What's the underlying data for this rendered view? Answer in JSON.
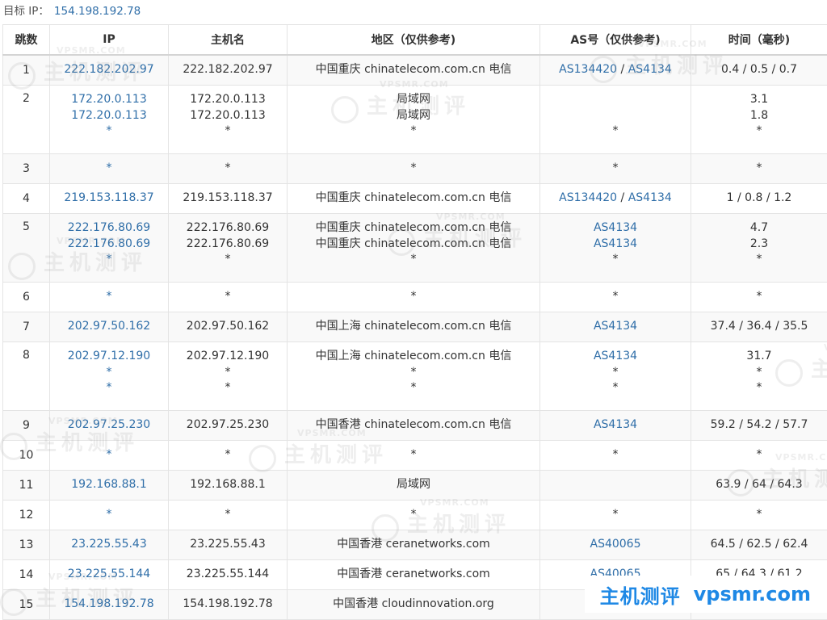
{
  "target": {
    "label": "目标 IP：",
    "ip": "154.198.192.78"
  },
  "headers": [
    "跳数",
    "IP",
    "主机名",
    "地区（仅供参考)",
    "AS号（仅供参考)",
    "时间（毫秒)"
  ],
  "hops": [
    {
      "hop": "1",
      "ip": [
        "222.182.202.97"
      ],
      "host": [
        "222.182.202.97"
      ],
      "region": [
        "中国重庆 chinatelecom.com.cn 电信"
      ],
      "as": [
        [
          "AS134420",
          "AS4134"
        ]
      ],
      "time": [
        "0.4 / 0.5 / 0.7"
      ]
    },
    {
      "hop": "2",
      "ip": [
        "172.20.0.113",
        "172.20.0.113",
        "*"
      ],
      "host": [
        "172.20.0.113",
        "172.20.0.113",
        "*"
      ],
      "region": [
        "局域网",
        "局域网",
        "*"
      ],
      "as": [
        [],
        [],
        [
          "*"
        ]
      ],
      "time": [
        "3.1",
        "1.8",
        "*"
      ]
    },
    {
      "hop": "3",
      "ip": [
        "*"
      ],
      "host": [
        "*"
      ],
      "region": [
        "*"
      ],
      "as": [
        [
          "*"
        ]
      ],
      "time": [
        "*"
      ]
    },
    {
      "hop": "4",
      "ip": [
        "219.153.118.37"
      ],
      "host": [
        "219.153.118.37"
      ],
      "region": [
        "中国重庆 chinatelecom.com.cn 电信"
      ],
      "as": [
        [
          "AS134420",
          "AS4134"
        ]
      ],
      "time": [
        "1 / 0.8 / 1.2"
      ]
    },
    {
      "hop": "5",
      "ip": [
        "222.176.80.69",
        "222.176.80.69",
        "*"
      ],
      "host": [
        "222.176.80.69",
        "222.176.80.69",
        "*"
      ],
      "region": [
        "中国重庆 chinatelecom.com.cn 电信",
        "中国重庆 chinatelecom.com.cn 电信",
        "*"
      ],
      "as": [
        [
          "AS4134"
        ],
        [
          "AS4134"
        ],
        [
          "*"
        ]
      ],
      "time": [
        "4.7",
        "2.3",
        "*"
      ]
    },
    {
      "hop": "6",
      "ip": [
        "*"
      ],
      "host": [
        "*"
      ],
      "region": [
        "*"
      ],
      "as": [
        [
          "*"
        ]
      ],
      "time": [
        "*"
      ]
    },
    {
      "hop": "7",
      "ip": [
        "202.97.50.162"
      ],
      "host": [
        "202.97.50.162"
      ],
      "region": [
        "中国上海 chinatelecom.com.cn 电信"
      ],
      "as": [
        [
          "AS4134"
        ]
      ],
      "time": [
        "37.4 / 36.4 / 35.5"
      ]
    },
    {
      "hop": "8",
      "ip": [
        "202.97.12.190",
        "*",
        "*"
      ],
      "host": [
        "202.97.12.190",
        "*",
        "*"
      ],
      "region": [
        "中国上海 chinatelecom.com.cn 电信",
        "*",
        "*"
      ],
      "as": [
        [
          "AS4134"
        ],
        [
          "*"
        ],
        [
          "*"
        ]
      ],
      "time": [
        "31.7",
        "*",
        "*"
      ]
    },
    {
      "hop": "9",
      "ip": [
        "202.97.25.230"
      ],
      "host": [
        "202.97.25.230"
      ],
      "region": [
        "中国香港 chinatelecom.com.cn 电信"
      ],
      "as": [
        [
          "AS4134"
        ]
      ],
      "time": [
        "59.2 / 54.2 / 57.7"
      ]
    },
    {
      "hop": "10",
      "ip": [
        "*"
      ],
      "host": [
        "*"
      ],
      "region": [
        "*"
      ],
      "as": [
        [
          "*"
        ]
      ],
      "time": [
        "*"
      ]
    },
    {
      "hop": "11",
      "ip": [
        "192.168.88.1"
      ],
      "host": [
        "192.168.88.1"
      ],
      "region": [
        "局域网"
      ],
      "as": [
        []
      ],
      "time": [
        "63.9 / 64 / 64.3"
      ]
    },
    {
      "hop": "12",
      "ip": [
        "*"
      ],
      "host": [
        "*"
      ],
      "region": [
        "*"
      ],
      "as": [
        [
          "*"
        ]
      ],
      "time": [
        "*"
      ]
    },
    {
      "hop": "13",
      "ip": [
        "23.225.55.43"
      ],
      "host": [
        "23.225.55.43"
      ],
      "region": [
        "中国香港 ceranetworks.com"
      ],
      "as": [
        [
          "AS40065"
        ]
      ],
      "time": [
        "64.5 / 62.5 / 62.4"
      ]
    },
    {
      "hop": "14",
      "ip": [
        "23.225.55.144"
      ],
      "host": [
        "23.225.55.144"
      ],
      "region": [
        "中国香港 ceranetworks.com"
      ],
      "as": [
        [
          "AS40065"
        ]
      ],
      "time": [
        "65 / 64.3 / 61.2"
      ]
    },
    {
      "hop": "15",
      "ip": [
        "154.198.192.78"
      ],
      "host": [
        "154.198.192.78"
      ],
      "region": [
        "中国香港 cloudinnovation.org"
      ],
      "as": [
        []
      ],
      "time": []
    }
  ],
  "watermark": {
    "url": "VPSMR.COM",
    "text": "主机测评"
  },
  "brand": {
    "cn": "主机测评",
    "domain": "vpsmr.com"
  },
  "colors": {
    "link": "#2f6ea8",
    "brand": "#1e88e5",
    "stripe": "#f9f9f9",
    "border": "#e4e4e4"
  }
}
